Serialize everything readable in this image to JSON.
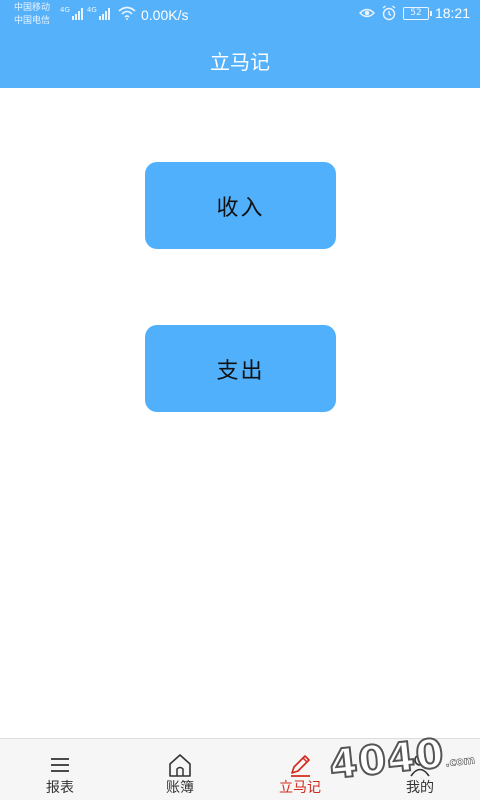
{
  "status_bar": {
    "carrier_1": "中国移动",
    "carrier_2": "中国电信",
    "network_type_1": "4G",
    "network_type_2": "4G",
    "net_speed": "0.00K/s",
    "battery_level": "52",
    "time": "18:21",
    "icons": [
      "signal-icon",
      "wifi-icon",
      "eye-icon",
      "alarm-icon",
      "battery-icon"
    ]
  },
  "header": {
    "title": "立马记"
  },
  "main": {
    "income_label": "收入",
    "expense_label": "支出"
  },
  "tab_bar": {
    "tabs": [
      {
        "label": "报表",
        "icon": "menu-icon",
        "active": false
      },
      {
        "label": "账簿",
        "icon": "home-icon",
        "active": false
      },
      {
        "label": "立马记",
        "icon": "pencil-icon",
        "active": true
      },
      {
        "label": "我的",
        "icon": "person-icon",
        "active": false
      }
    ]
  },
  "watermark": {
    "text": "4040",
    "suffix": ".com"
  },
  "colors": {
    "primary": "#56b1fb",
    "button": "#50b0fb",
    "active_tab": "#d42a1c",
    "tab_bar_bg": "#f6f6f6"
  }
}
